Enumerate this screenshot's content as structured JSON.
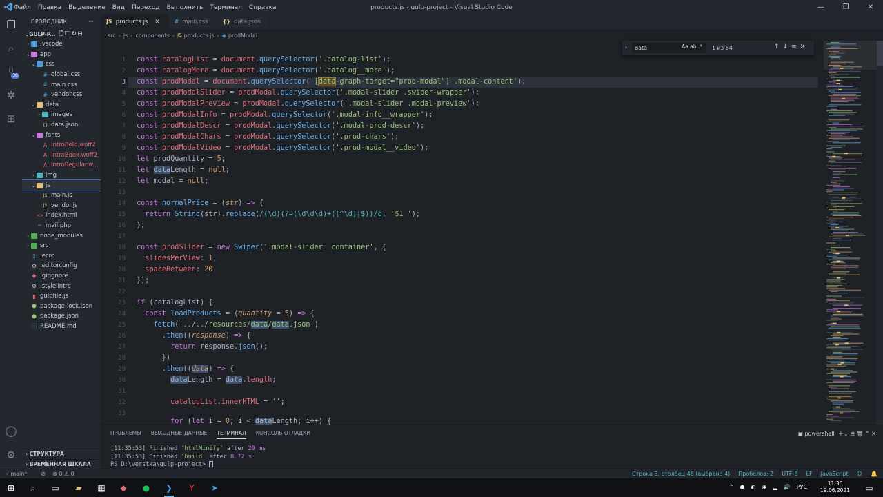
{
  "titlebar": {
    "menu": [
      "Файл",
      "Правка",
      "Выделение",
      "Вид",
      "Переход",
      "Выполнить",
      "Терминал",
      "Справка"
    ],
    "title": "products.js - gulp-project - Visual Studio Code"
  },
  "sidebar": {
    "header": "ПРОВОДНИК",
    "root": "GULP-P...",
    "items": [
      {
        "label": ".vscode",
        "type": "folder",
        "color": "blue",
        "depth": 1,
        "chev": "›"
      },
      {
        "label": "app",
        "type": "folder",
        "color": "pink",
        "depth": 1,
        "chev": "⌄"
      },
      {
        "label": "css",
        "type": "folder",
        "color": "blue",
        "depth": 2,
        "chev": "⌄"
      },
      {
        "label": "global.css",
        "type": "css",
        "depth": 3
      },
      {
        "label": "main.css",
        "type": "css",
        "depth": 3
      },
      {
        "label": "vendor.css",
        "type": "css",
        "depth": 3
      },
      {
        "label": "data",
        "type": "folder",
        "color": "yellow",
        "depth": 2,
        "chev": "⌄"
      },
      {
        "label": "images",
        "type": "folder",
        "color": "teal",
        "depth": 3,
        "chev": "›"
      },
      {
        "label": "data.json",
        "type": "json",
        "depth": 3
      },
      {
        "label": "fonts",
        "type": "folder",
        "color": "pink",
        "depth": 2,
        "chev": "⌄"
      },
      {
        "label": "IntroBold.woff2",
        "type": "font",
        "depth": 3
      },
      {
        "label": "IntroBook.woff2",
        "type": "font",
        "depth": 3
      },
      {
        "label": "IntroRegular.w...",
        "type": "font",
        "depth": 3
      },
      {
        "label": "img",
        "type": "folder",
        "color": "teal",
        "depth": 2,
        "chev": "›"
      },
      {
        "label": "js",
        "type": "folder",
        "color": "yellow",
        "depth": 2,
        "chev": "⌄",
        "selected": true
      },
      {
        "label": "main.js",
        "type": "js",
        "depth": 3
      },
      {
        "label": "vendor.js",
        "type": "js",
        "depth": 3
      },
      {
        "label": "index.html",
        "type": "html",
        "depth": 2
      },
      {
        "label": "mail.php",
        "type": "php",
        "depth": 2
      },
      {
        "label": "node_modules",
        "type": "folder",
        "color": "green",
        "depth": 1,
        "chev": "›"
      },
      {
        "label": "src",
        "type": "folder",
        "color": "green",
        "depth": 1,
        "chev": "›"
      },
      {
        "label": ".ecrc",
        "type": "file",
        "depth": 1
      },
      {
        "label": ".editorconfig",
        "type": "cfg",
        "depth": 1
      },
      {
        "label": ".gitignore",
        "type": "git",
        "depth": 1
      },
      {
        "label": ".stylelintrc",
        "type": "cfg",
        "depth": 1
      },
      {
        "label": "gulpfile.js",
        "type": "gulp",
        "depth": 1
      },
      {
        "label": "package-lock.json",
        "type": "npm",
        "depth": 1
      },
      {
        "label": "package.json",
        "type": "npm",
        "depth": 1
      },
      {
        "label": "README.md",
        "type": "md",
        "depth": 1
      }
    ],
    "outline": "СТРУКТУРА",
    "timeline": "ВРЕМЕННАЯ ШКАЛА"
  },
  "tabs": [
    {
      "label": "products.js",
      "icon": "JS",
      "active": true
    },
    {
      "label": "main.css",
      "icon": "#",
      "active": false
    },
    {
      "label": "data.json",
      "icon": "{}",
      "active": false
    }
  ],
  "breadcrumb": [
    "src",
    "js",
    "components",
    "products.js",
    "prodModal"
  ],
  "find": {
    "value": "data",
    "options": "Aa  ab  .*",
    "count": "1 из 64"
  },
  "panel": {
    "tabs": [
      "ПРОБЛЕМЫ",
      "ВЫХОДНЫЕ ДАННЫЕ",
      "ТЕРМИНАЛ",
      "КОНСОЛЬ ОТЛАДКИ"
    ],
    "active_tab": "ТЕРМИНАЛ",
    "shell": "powershell",
    "lines": [
      {
        "time": "[11:35:53]",
        "text": " Finished ",
        "task": "'htmlMinify'",
        "after": " after ",
        "dur": "29 ms"
      },
      {
        "time": "[11:35:53]",
        "text": " Finished ",
        "task": "'build'",
        "after": " after ",
        "dur": "8.72 s"
      }
    ],
    "prompt": "PS D:\\verstka\\gulp-project> "
  },
  "statusbar": {
    "branch": "main*",
    "sync": "⊘",
    "problems": "⊗ 0 ⚠ 0",
    "position": "Строка 3, столбец 48 (выбрано 4)",
    "spaces": "Пробелов: 2",
    "encoding": "UTF-8",
    "eol": "LF",
    "language": "JavaScript"
  },
  "taskbar": {
    "lang": "РУС",
    "time": "11:36",
    "date": "19.06.2021"
  },
  "code_lines": [
    "1",
    "2",
    "3",
    "4",
    "5",
    "6",
    "7",
    "8",
    "9",
    "10",
    "11",
    "12",
    "13",
    "14",
    "15",
    "16",
    "17",
    "18",
    "19",
    "20",
    "21",
    "22",
    "23",
    "24",
    "25",
    "26",
    "27",
    "28",
    "29",
    "30",
    "31",
    "32",
    "33"
  ]
}
